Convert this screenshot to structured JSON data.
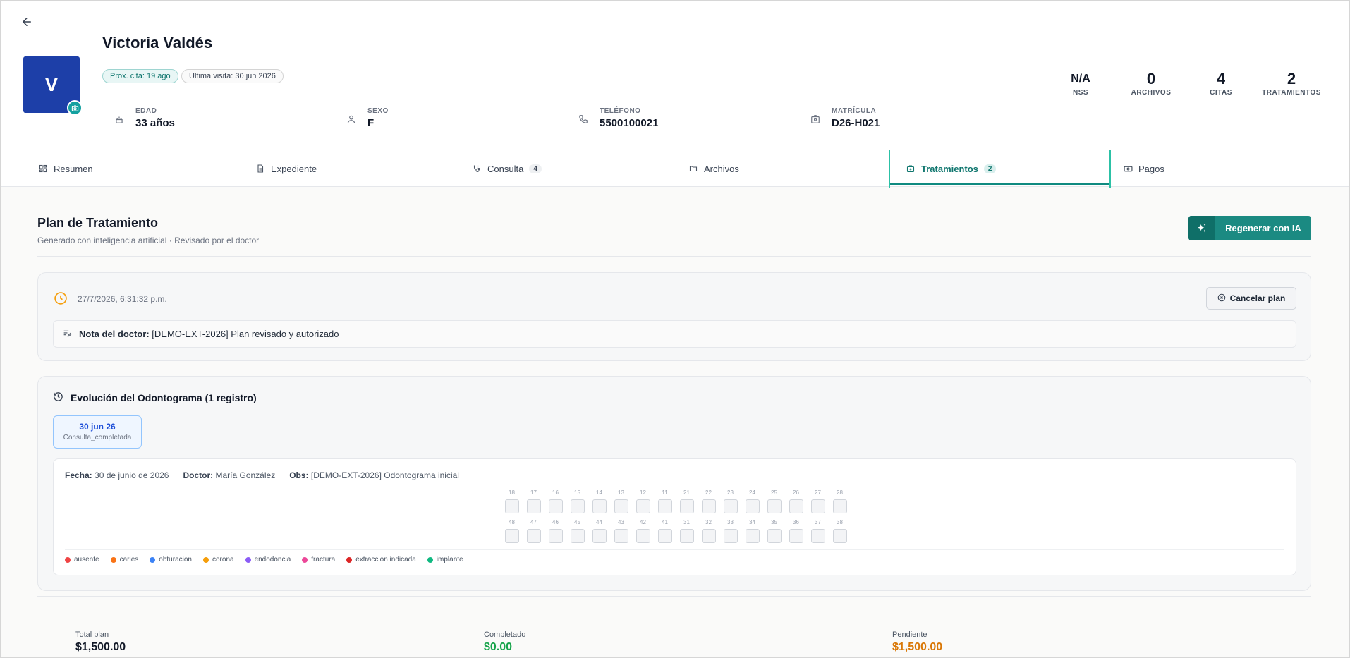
{
  "patient": {
    "name": "Victoria Valdés",
    "initial": "V",
    "next_appointment": "Prox. cita: 19 ago",
    "last_visit": "Ultima visita: 30 jun 2026",
    "info": [
      {
        "label": "EDAD",
        "value": "33 años",
        "icon": "cake-icon"
      },
      {
        "label": "SEXO",
        "value": "F",
        "icon": "user-icon"
      },
      {
        "label": "TELÉFONO",
        "value": "5500100021",
        "icon": "phone-icon"
      },
      {
        "label": "MATRÍCULA",
        "value": "D26-H021",
        "icon": "id-card-icon"
      }
    ],
    "stats": [
      {
        "value": "N/A",
        "label": "NSS"
      },
      {
        "value": "0",
        "label": "ARCHIVOS"
      },
      {
        "value": "4",
        "label": "CITAS"
      },
      {
        "value": "2",
        "label": "TRATAMIENTOS"
      }
    ]
  },
  "tabs": [
    {
      "label": "Resumen",
      "icon": "dashboard-icon",
      "badge": ""
    },
    {
      "label": "Expediente",
      "icon": "document-icon",
      "badge": ""
    },
    {
      "label": "Consulta",
      "icon": "stethoscope-icon",
      "badge": "4"
    },
    {
      "label": "Archivos",
      "icon": "folder-icon",
      "badge": ""
    },
    {
      "label": "Tratamientos",
      "icon": "medical-kit-icon",
      "badge": "2",
      "active": true
    },
    {
      "label": "Pagos",
      "icon": "cash-icon",
      "badge": ""
    }
  ],
  "plan": {
    "title": "Plan de Tratamiento",
    "subtitle": "Generado con inteligencia artificial · Revisado por el doctor",
    "regenerate_label": "Regenerar con IA",
    "timestamp": "27/7/2026, 6:31:32 p.m.",
    "cancel_label": "Cancelar plan",
    "note_label": "Nota del doctor:",
    "note_text": "[DEMO-EXT-2026] Plan revisado y autorizado"
  },
  "odontogram": {
    "title": "Evolución del Odontograma (1 registro)",
    "chip_date": "30 jun 26",
    "chip_status": "Consulta_completada",
    "fecha_label": "Fecha:",
    "fecha_value": "30 de junio de 2026",
    "doctor_label": "Doctor:",
    "doctor_value": "María González",
    "obs_label": "Obs:",
    "obs_value": "[DEMO-EXT-2026] Odontograma inicial",
    "upper_teeth": [
      "18",
      "17",
      "16",
      "15",
      "14",
      "13",
      "12",
      "11",
      "21",
      "22",
      "23",
      "24",
      "25",
      "26",
      "27",
      "28"
    ],
    "lower_teeth": [
      "48",
      "47",
      "46",
      "45",
      "44",
      "43",
      "42",
      "41",
      "31",
      "32",
      "33",
      "34",
      "35",
      "36",
      "37",
      "38"
    ],
    "legend": [
      {
        "label": "ausente",
        "color": "#ef4444"
      },
      {
        "label": "caries",
        "color": "#f97316"
      },
      {
        "label": "obturacion",
        "color": "#3b82f6"
      },
      {
        "label": "corona",
        "color": "#f59e0b"
      },
      {
        "label": "endodoncia",
        "color": "#8b5cf6"
      },
      {
        "label": "fractura",
        "color": "#ec4899"
      },
      {
        "label": "extraccion indicada",
        "color": "#dc2626"
      },
      {
        "label": "implante",
        "color": "#10b981"
      }
    ]
  },
  "totals": [
    {
      "label": "Total plan",
      "value": "$1,500.00",
      "color": "#111827"
    },
    {
      "label": "Completado",
      "value": "$0.00",
      "color": "#16a34a"
    },
    {
      "label": "Pendiente",
      "value": "$1,500.00",
      "color": "#d97706"
    }
  ]
}
